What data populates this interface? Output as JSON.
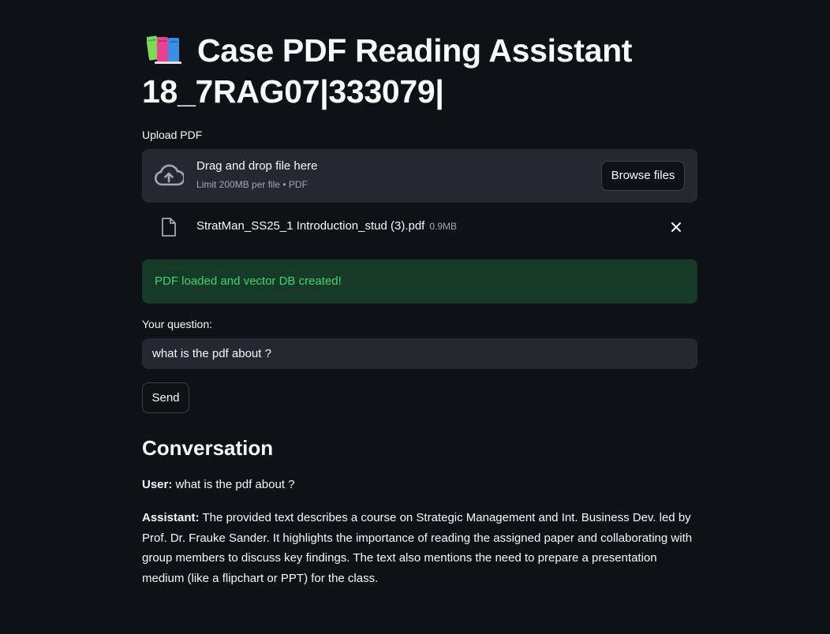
{
  "header": {
    "title_line1": "Case PDF Reading Assistant",
    "title_line2": "18_7RAG07|333079|",
    "emoji_icon": "books-icon"
  },
  "uploader": {
    "label": "Upload PDF",
    "drop_text": "Drag and drop file here",
    "limit_text": "Limit 200MB per file • PDF",
    "browse_label": "Browse files",
    "icon": "cloud-upload-icon"
  },
  "uploaded_file": {
    "name": "StratMan_SS25_1 Introduction_stud (3).pdf",
    "size": "0.9MB",
    "icon": "file-icon",
    "remove_icon": "close-icon"
  },
  "status": {
    "message": "PDF loaded and vector DB created!",
    "color": "#3dd56d",
    "background": "#173928"
  },
  "question": {
    "label": "Your question:",
    "value": "what is the pdf about ?"
  },
  "send_label": "Send",
  "conversation": {
    "heading": "Conversation",
    "messages": [
      {
        "role": "User:",
        "text": "what is the pdf about ?"
      },
      {
        "role": "Assistant:",
        "text": "The provided text describes a course on Strategic Management and Int. Business Dev. led by Prof. Dr. Frauke Sander. It highlights the importance of reading the assigned paper and collaborating with group members to discuss key findings. The text also mentions the need to prepare a presentation medium (like a flipchart or PPT) for the class."
      }
    ]
  },
  "colors": {
    "background": "#0e1117",
    "surface": "#262730",
    "text": "#fafafa",
    "muted": "#a3a8b8"
  }
}
